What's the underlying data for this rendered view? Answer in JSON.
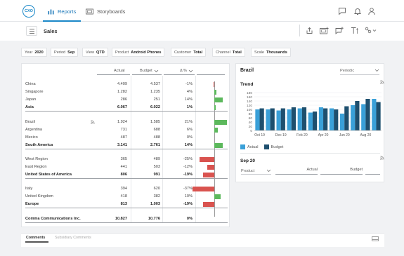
{
  "app": {
    "logo": "CXO",
    "nav": [
      {
        "label": "Reports"
      },
      {
        "label": "Storyboards"
      }
    ]
  },
  "header": {
    "title": "Sales"
  },
  "filters": [
    {
      "label": "Year",
      "value": "2020"
    },
    {
      "label": "Period",
      "value": "Sep"
    },
    {
      "label": "View",
      "value": "QTD"
    },
    {
      "label": "Product",
      "value": "Android Phones"
    },
    {
      "label": "Customer",
      "value": "Total"
    },
    {
      "label": "Channel",
      "value": "Total"
    },
    {
      "label": "Scale",
      "value": "Thousands"
    }
  ],
  "table": {
    "headers": {
      "actual": "Actual",
      "budget": "Budget",
      "delta": "Δ %"
    },
    "rows": [
      {
        "name": "China",
        "actual": "4.409",
        "budget": "4.537",
        "delta": "-1%",
        "pct": -1,
        "total": false
      },
      {
        "name": "Singapore",
        "actual": "1.282",
        "budget": "1.235",
        "delta": "4%",
        "pct": 4,
        "total": false
      },
      {
        "name": "Japan",
        "actual": "286",
        "budget": "251",
        "delta": "14%",
        "pct": 14,
        "total": false
      },
      {
        "name": "Asia",
        "actual": "6.067",
        "budget": "6.022",
        "delta": "1%",
        "pct": 1,
        "total": true
      },
      {
        "name": "Brazil",
        "actual": "1.924",
        "budget": "1.585",
        "delta": "21%",
        "pct": 21,
        "total": false,
        "feed": true
      },
      {
        "name": "Argentina",
        "actual": "731",
        "budget": "688",
        "delta": "6%",
        "pct": 6,
        "total": false
      },
      {
        "name": "Mexico",
        "actual": "487",
        "budget": "488",
        "delta": "0%",
        "pct": 0,
        "total": false
      },
      {
        "name": "South America",
        "actual": "3.141",
        "budget": "2.761",
        "delta": "14%",
        "pct": 14,
        "total": true
      },
      {
        "name": "West Region",
        "actual": "365",
        "budget": "489",
        "delta": "-25%",
        "pct": -25,
        "total": false
      },
      {
        "name": "East Region",
        "actual": "441",
        "budget": "503",
        "delta": "-12%",
        "pct": -12,
        "total": false
      },
      {
        "name": "United States of America",
        "actual": "806",
        "budget": "991",
        "delta": "-19%",
        "pct": -19,
        "total": true
      },
      {
        "name": "Italy",
        "actual": "394",
        "budget": "620",
        "delta": "-37%",
        "pct": -37,
        "total": false
      },
      {
        "name": "United Kingdom",
        "actual": "418",
        "budget": "382",
        "delta": "10%",
        "pct": 10,
        "total": false
      },
      {
        "name": "Europe",
        "actual": "813",
        "budget": "1.003",
        "delta": "-19%",
        "pct": -19,
        "total": true
      },
      {
        "name": "Comma Communications Inc.",
        "actual": "10.827",
        "budget": "10.776",
        "delta": "0%",
        "pct": 0,
        "total": true
      }
    ]
  },
  "detail": {
    "title": "Brazil",
    "period_select": "Periodic",
    "trend_title": "Trend",
    "sep_title": "Sep 20",
    "product_label": "Product",
    "actual_label": "Actual",
    "budget_label": "Budget"
  },
  "chart_data": {
    "type": "bar",
    "title": "Trend",
    "x": [
      "Oct 19",
      "Nov 19",
      "Dec 19",
      "Jan 20",
      "Feb 20",
      "Mar 20",
      "Apr 20",
      "May 20",
      "Jun 20",
      "Jul 20",
      "Aug 20",
      "Sep 20"
    ],
    "xticklabels": [
      "Oct 19",
      "Dec 19",
      "Feb 20",
      "Apr 20",
      "Jun 20",
      "Aug 20"
    ],
    "yticks": [
      0,
      20,
      40,
      60,
      80,
      100,
      120,
      140,
      160,
      180
    ],
    "ylim": [
      0,
      180
    ],
    "series": [
      {
        "name": "Actual",
        "color": "#3aa0d8",
        "values": [
          100,
          100,
          95,
          100,
          105,
          85,
          110,
          105,
          80,
          120,
          125,
          150
        ]
      },
      {
        "name": "Budget",
        "color": "#1e4f6e",
        "values": [
          105,
          105,
          105,
          110,
          110,
          90,
          105,
          100,
          115,
          140,
          150,
          135
        ]
      }
    ],
    "legend": "bottom-left"
  },
  "comments": {
    "tabs": [
      "Comments",
      "Subsidiary Comments"
    ]
  },
  "colors": {
    "accent": "#1b88c8",
    "positive": "#5cb85c",
    "negative": "#d9534f"
  }
}
